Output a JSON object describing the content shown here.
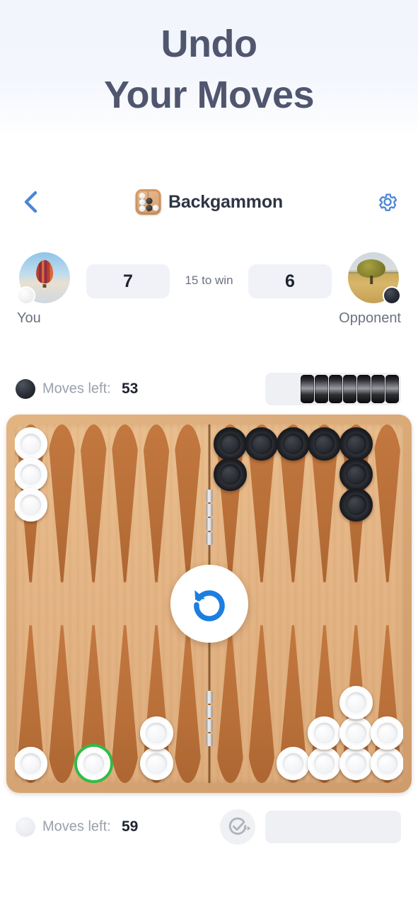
{
  "promo": {
    "line1": "Undo",
    "line2": "Your Moves"
  },
  "navbar": {
    "back_icon": "chevron-left-icon",
    "app_icon": "backgammon-board-icon",
    "title": "Backgammon",
    "settings_icon": "gear-icon"
  },
  "scorebar": {
    "you": {
      "name": "You",
      "score": "7",
      "avatar": "hot-air-balloon-avatar",
      "checker_color": "white"
    },
    "opponent": {
      "name": "Opponent",
      "score": "6",
      "avatar": "lone-tree-field-avatar",
      "checker_color": "black"
    },
    "target": "15 to win"
  },
  "moves": {
    "black": {
      "label": "Moves left:",
      "count": "53",
      "checker_color": "black",
      "borne_off": 7
    },
    "white": {
      "label": "Moves left:",
      "count": "59",
      "checker_color": "white",
      "borne_off": 0,
      "confirm_icon": "confirm-skip-icon"
    }
  },
  "board": {
    "undo_icon": "undo-arrow-icon",
    "selected_point": "bottom-left-3",
    "selection_color": "#2fbd46",
    "top_left": [
      3,
      0,
      0,
      0,
      0,
      0
    ],
    "top_right": [
      2,
      1,
      1,
      1,
      3,
      0
    ],
    "bottom_left": [
      1,
      0,
      1,
      0,
      2,
      0
    ],
    "bottom_right": [
      0,
      0,
      1,
      2,
      3,
      2
    ]
  },
  "colors": {
    "accent_blue": "#3b82d6",
    "heading": "#50566e",
    "board_frame": "#d9a877",
    "board_field": "#e3b383",
    "point_brown": "#b86f38",
    "white_checker": "#ffffff",
    "black_checker": "#1a1c21"
  }
}
